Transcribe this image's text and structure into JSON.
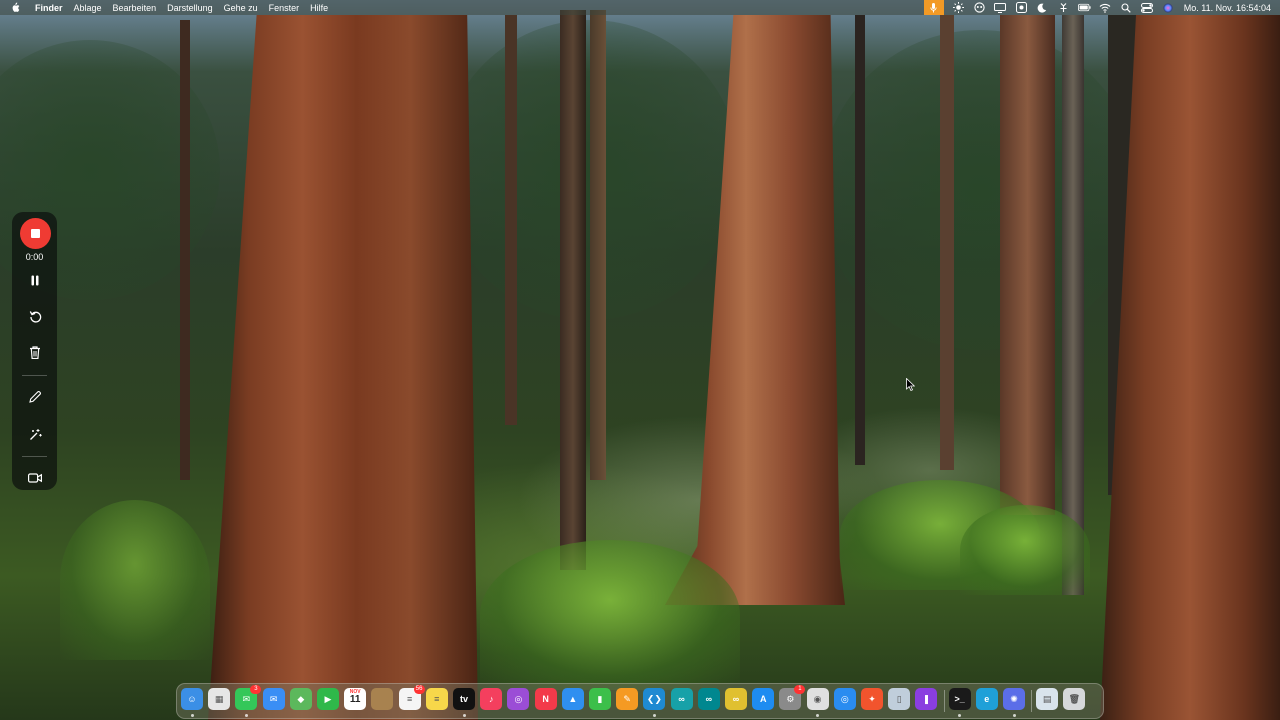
{
  "menubar": {
    "app_name": "Finder",
    "menus": [
      "Ablage",
      "Bearbeiten",
      "Darstellung",
      "Gehe zu",
      "Fenster",
      "Hilfe"
    ],
    "clock": "Mo. 11. Nov.  16:54:04",
    "status_icons": [
      "microphone-icon",
      "brightness-icon",
      "screen-record-icon",
      "display-icon",
      "screen-time-icon",
      "focus-moon-icon",
      "link-icon",
      "battery-icon",
      "wifi-icon",
      "spotlight-search-icon",
      "control-center-icon",
      "siri-icon"
    ],
    "mic_color": "#f29a26"
  },
  "recorder": {
    "elapsed": "0:00",
    "stop_color": "#ef3b33",
    "buttons": [
      "pause-icon",
      "restart-icon",
      "trash-icon",
      "pencil-icon",
      "effects-icon",
      "camera-icon"
    ]
  },
  "dock": {
    "apps": [
      {
        "name": "Finder",
        "icon": "finder-icon",
        "color": "#3b8fe6",
        "glyph": "☺"
      },
      {
        "name": "Launchpad",
        "icon": "launchpad-icon",
        "color": "#e6e6e6",
        "glyph": "▦"
      },
      {
        "name": "Messages",
        "icon": "messages-icon",
        "color": "#34c759",
        "glyph": "✉",
        "badge": "3"
      },
      {
        "name": "Mail",
        "icon": "mail-icon",
        "color": "#3a8ef5",
        "glyph": "✉"
      },
      {
        "name": "Maps",
        "icon": "maps-icon",
        "color": "#5cb85c",
        "glyph": "◆"
      },
      {
        "name": "FaceTime",
        "icon": "facetime-icon",
        "color": "#2fb84a",
        "glyph": "▶"
      },
      {
        "name": "Calendar",
        "icon": "calendar-icon",
        "color": "#ffffff",
        "glyph": "11",
        "month": "NOV"
      },
      {
        "name": "Notes App",
        "icon": "notebook-icon",
        "color": "#a8824f",
        "glyph": ""
      },
      {
        "name": "Reminders",
        "icon": "reminders-icon",
        "color": "#f5f5f5",
        "glyph": "≡",
        "badge": "56"
      },
      {
        "name": "Notes",
        "icon": "notes-icon",
        "color": "#f7d74a",
        "glyph": "≡"
      },
      {
        "name": "TV",
        "icon": "apple-tv-icon",
        "color": "#111111",
        "glyph": "tv"
      },
      {
        "name": "Music",
        "icon": "music-icon",
        "color": "#f43f5e",
        "glyph": "♪"
      },
      {
        "name": "Podcasts",
        "icon": "podcasts-icon",
        "color": "#9b4dd6",
        "glyph": "◎"
      },
      {
        "name": "News",
        "icon": "news-icon",
        "color": "#f33a4a",
        "glyph": "N"
      },
      {
        "name": "Keynote",
        "icon": "keynote-icon",
        "color": "#2f8ff0",
        "glyph": "▲"
      },
      {
        "name": "Numbers",
        "icon": "numbers-icon",
        "color": "#3cbf4a",
        "glyph": "▮"
      },
      {
        "name": "Pages",
        "icon": "pages-icon",
        "color": "#f59a23",
        "glyph": "✎"
      },
      {
        "name": "Visual Studio Code",
        "icon": "vscode-icon",
        "color": "#1f8ad2",
        "glyph": "❮❯"
      },
      {
        "name": "Arduino",
        "icon": "arduino-icon",
        "color": "#17a1a8",
        "glyph": "∞"
      },
      {
        "name": "Arduino IDE",
        "icon": "arduino-ide-icon",
        "color": "#00878f",
        "glyph": "∞"
      },
      {
        "name": "Arduino Legacy",
        "icon": "arduino-legacy-icon",
        "color": "#e0c030",
        "glyph": "∞"
      },
      {
        "name": "App Store",
        "icon": "app-store-icon",
        "color": "#1e8cf1",
        "glyph": "A"
      },
      {
        "name": "System Settings",
        "icon": "settings-icon",
        "color": "#8a8a8a",
        "glyph": "⚙",
        "badge": "1"
      },
      {
        "name": "Chrome",
        "icon": "chrome-icon",
        "color": "#e0e0e0",
        "glyph": "◉"
      },
      {
        "name": "Safari",
        "icon": "safari-icon",
        "color": "#2a8cf0",
        "glyph": "◎"
      },
      {
        "name": "Paw",
        "icon": "paw-icon",
        "color": "#f2542d",
        "glyph": "✦"
      },
      {
        "name": "Preview",
        "icon": "preview-icon",
        "color": "#c0cedb",
        "glyph": "▯"
      },
      {
        "name": "Clips",
        "icon": "clips-icon",
        "color": "#8a3ee0",
        "glyph": "❚"
      },
      {
        "name": "Terminal",
        "icon": "terminal-icon",
        "color": "#1a1a1a",
        "glyph": ">_"
      },
      {
        "name": "Edge",
        "icon": "edge-icon",
        "color": "#1fa0d8",
        "glyph": "e"
      },
      {
        "name": "Recorder",
        "icon": "recorder-icon",
        "color": "#5b6ee8",
        "glyph": "✺"
      },
      {
        "name": "Downloads",
        "icon": "downloads-folder-icon",
        "color": "#d9e4ec",
        "glyph": "▤"
      },
      {
        "name": "Trash",
        "icon": "trash-icon",
        "color": "#d6d8da",
        "glyph": "🗑"
      }
    ]
  }
}
